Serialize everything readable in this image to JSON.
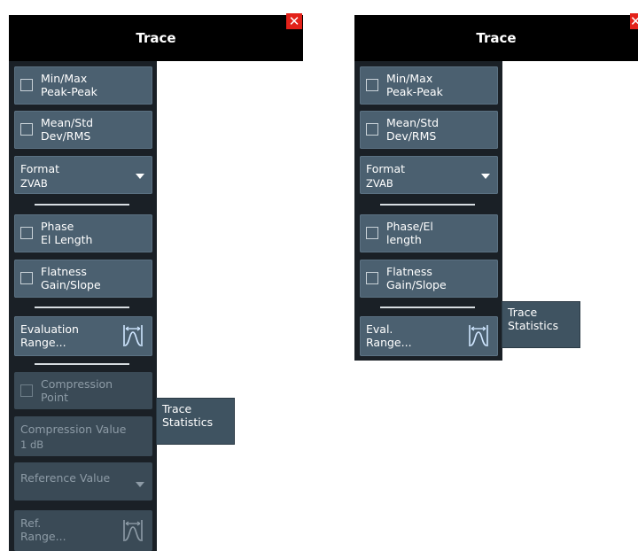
{
  "left_panel": {
    "title": "Trace",
    "close_symbol": "✕",
    "buttons": {
      "minmax": "Min/Max\nPeak-Peak",
      "meanstd": "Mean/Std\nDev/RMS",
      "format_label": "Format",
      "format_value": "ZVAB",
      "phase": "Phase\nEl Length",
      "flatness": "Flatness\nGain/Slope",
      "eval_range": "Evaluation\nRange...",
      "compression_point": "Compression\nPoint",
      "compression_value_label": "Compression Value",
      "compression_value": "1 dB",
      "reference_value": "Reference Value",
      "ref_range": "Ref.\nRange..."
    },
    "tag": "Trace\nStatistics"
  },
  "right_panel": {
    "title": "Trace",
    "close_symbol": "✕",
    "buttons": {
      "minmax": "Min/Max\nPeak-Peak",
      "meanstd": "Mean/Std\nDev/RMS",
      "format_label": "Format",
      "format_value": "ZVAB",
      "phase": "Phase/El\nlength",
      "flatness": "Flatness\nGain/Slope",
      "eval_range": "Eval.\nRange..."
    },
    "tag": "Trace\nStatistics"
  },
  "colors": {
    "title_bar": "#000000",
    "button": "#4b6070",
    "button_disabled": "#3a4a56",
    "strip": "#1a2026",
    "close": "#e32119",
    "icon": "#cfe6ff"
  },
  "icons": [
    "close-icon",
    "range-icon",
    "dropdown-caret-icon",
    "checkbox-icon"
  ]
}
